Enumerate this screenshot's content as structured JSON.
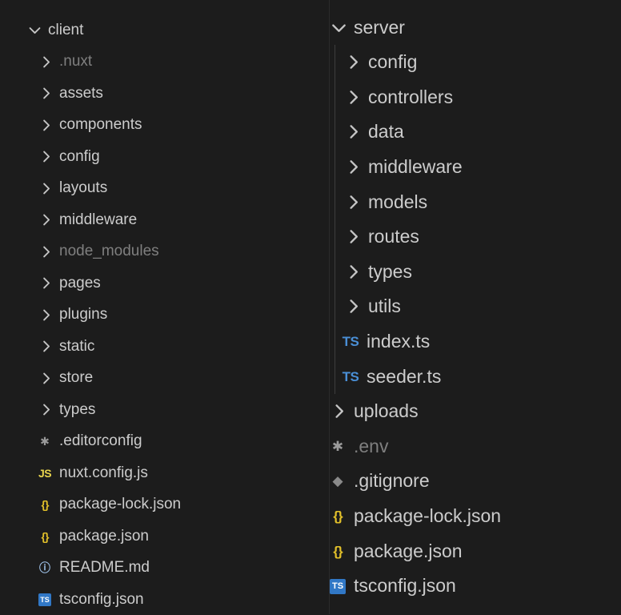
{
  "left": {
    "root": {
      "label": "client",
      "expanded": true
    },
    "items": [
      {
        "label": ".nuxt",
        "kind": "folder",
        "dim": true
      },
      {
        "label": "assets",
        "kind": "folder",
        "dim": false
      },
      {
        "label": "components",
        "kind": "folder",
        "dim": false
      },
      {
        "label": "config",
        "kind": "folder",
        "dim": false
      },
      {
        "label": "layouts",
        "kind": "folder",
        "dim": false
      },
      {
        "label": "middleware",
        "kind": "folder",
        "dim": false
      },
      {
        "label": "node_modules",
        "kind": "folder",
        "dim": true
      },
      {
        "label": "pages",
        "kind": "folder",
        "dim": false
      },
      {
        "label": "plugins",
        "kind": "folder",
        "dim": false
      },
      {
        "label": "static",
        "kind": "folder",
        "dim": false
      },
      {
        "label": "store",
        "kind": "folder",
        "dim": false
      },
      {
        "label": "types",
        "kind": "folder",
        "dim": false
      },
      {
        "label": ".editorconfig",
        "kind": "file",
        "icon": "gear-icon",
        "glyph": "✱",
        "dim": false
      },
      {
        "label": "nuxt.config.js",
        "kind": "file",
        "icon": "javascript-file-icon",
        "glyph": "JS",
        "dim": false
      },
      {
        "label": "package-lock.json",
        "kind": "file",
        "icon": "json-file-icon",
        "glyph": "{}",
        "dim": false
      },
      {
        "label": "package.json",
        "kind": "file",
        "icon": "json-file-icon",
        "glyph": "{}",
        "dim": false
      },
      {
        "label": "README.md",
        "kind": "file",
        "icon": "info-icon",
        "glyph": "ⓘ",
        "dim": false
      },
      {
        "label": "tsconfig.json",
        "kind": "file",
        "icon": "tsconfig-file-icon",
        "glyph": "TS",
        "dim": false
      }
    ]
  },
  "right": {
    "root": {
      "label": "server",
      "expanded": true
    },
    "children": [
      {
        "label": "config",
        "kind": "folder"
      },
      {
        "label": "controllers",
        "kind": "folder"
      },
      {
        "label": "data",
        "kind": "folder"
      },
      {
        "label": "middleware",
        "kind": "folder"
      },
      {
        "label": "models",
        "kind": "folder"
      },
      {
        "label": "routes",
        "kind": "folder"
      },
      {
        "label": "types",
        "kind": "folder"
      },
      {
        "label": "utils",
        "kind": "folder"
      },
      {
        "label": "index.ts",
        "kind": "file",
        "icon": "typescript-file-icon",
        "glyph": "TS"
      },
      {
        "label": "seeder.ts",
        "kind": "file",
        "icon": "typescript-file-icon",
        "glyph": "TS"
      }
    ],
    "siblings": [
      {
        "label": "uploads",
        "kind": "folder",
        "dim": false
      },
      {
        "label": ".env",
        "kind": "file",
        "icon": "gear-icon",
        "glyph": "✱",
        "dim": true
      },
      {
        "label": ".gitignore",
        "kind": "file",
        "icon": "git-icon",
        "glyph": "◆",
        "dim": false
      },
      {
        "label": "package-lock.json",
        "kind": "file",
        "icon": "json-file-icon",
        "glyph": "{}",
        "dim": false
      },
      {
        "label": "package.json",
        "kind": "file",
        "icon": "json-file-icon",
        "glyph": "{}",
        "dim": false
      },
      {
        "label": "tsconfig.json",
        "kind": "file",
        "icon": "tsconfig-file-icon",
        "glyph": "TS",
        "dim": false
      }
    ]
  },
  "colors": {
    "background": "#1c1c1c",
    "text": "#cccccc",
    "dimmed": "#7f7f7f",
    "typescript": "#3178c6",
    "json": "#e2c02a",
    "javascript": "#e8d44d"
  }
}
